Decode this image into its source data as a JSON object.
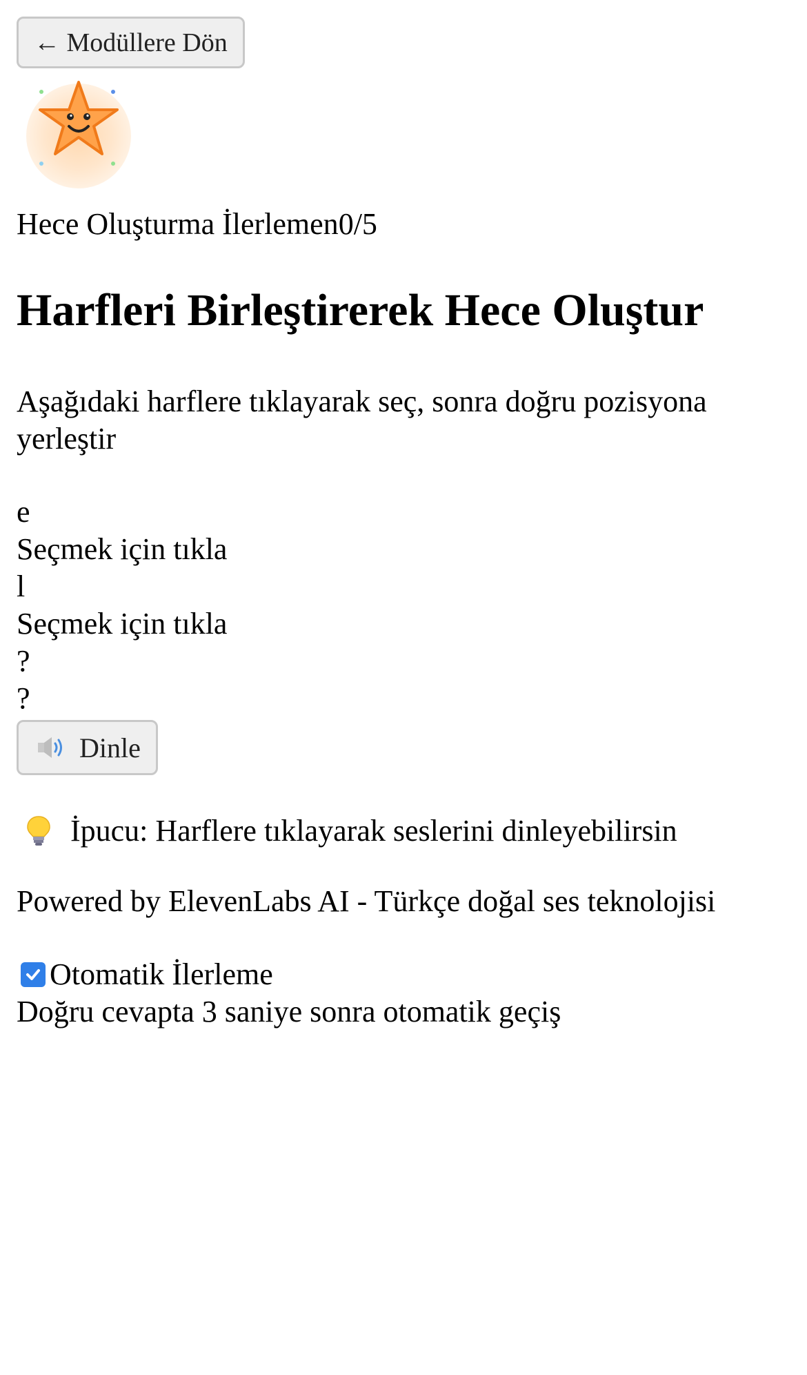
{
  "header": {
    "back_label": "← Modüllere Dön"
  },
  "mascot": {
    "icon": "smiling-star-icon"
  },
  "progress": {
    "label": "Hece Oluşturma İlerlemen",
    "value": "0/5"
  },
  "main": {
    "title": "Harfleri Birleştirerek Hece Oluştur",
    "instruction": "Aşağıdaki harflere tıklayarak seç, sonra doğru pozisyona yerleştir",
    "letters": [
      {
        "letter": "e",
        "hint": "Seçmek için tıkla"
      },
      {
        "letter": "l",
        "hint": "Seçmek için tıkla"
      }
    ],
    "slots": [
      "?",
      "?"
    ],
    "listen_label": "Dinle",
    "tip": "İpucu: Harflere tıklayarak seslerini dinleyebilirsin",
    "powered": "Powered by ElevenLabs AI - Türkçe doğal ses teknolojisi"
  },
  "auto_advance": {
    "label": "Otomatik İlerleme",
    "checked": true,
    "description": "Doğru cevapta 3 saniye sonra otomatik geçiş"
  },
  "colors": {
    "accent": "#2f7fe8",
    "star": "#ff9a3c",
    "star_outline": "#f07a1a"
  }
}
